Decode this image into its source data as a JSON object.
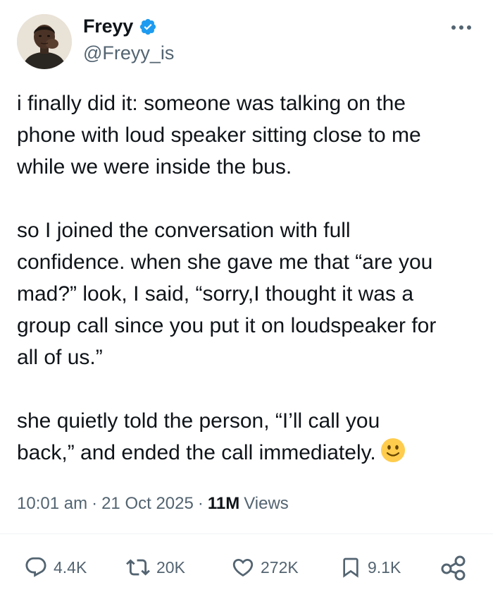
{
  "user": {
    "display_name": "Freyy",
    "handle": "@Freyy_is",
    "verified": true
  },
  "tweet": {
    "paragraphs": [
      "i finally did it: someone was talking on the\nphone with loud speaker sitting close to me\nwhile we were inside the bus.",
      "so I joined the conversation with full\nconfidence. when she gave me that “are you\nmad?” look, I said, “sorry,I thought it was a\ngroup call since you put it on loudspeaker for\nall of us.”",
      "she quietly told the person, “I’ll call you\nback,” and ended the call immediately."
    ],
    "emoji": "slightly-smiling-face"
  },
  "meta": {
    "time": "10:01 am",
    "separator": "·",
    "date": "21 Oct 2025",
    "views_count": "11M",
    "views_label": "Views"
  },
  "actions": {
    "replies": "4.4K",
    "reposts": "20K",
    "likes": "272K",
    "bookmarks": "9.1K"
  },
  "colors": {
    "verified_blue": "#1d9bf0",
    "secondary_text": "#536471",
    "primary_text": "#0f1419"
  }
}
